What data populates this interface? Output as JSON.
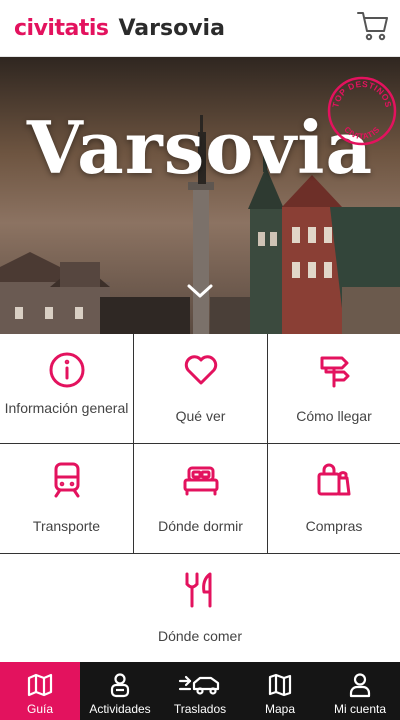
{
  "header": {
    "logo": "civitatis",
    "city": "Varsovia",
    "cart_icon": "cart-icon"
  },
  "hero": {
    "title": "Varsovia",
    "badge_top": "TOP DESTINOS",
    "badge_bottom": "CIVITATIS",
    "scroll_icon": "chevron-down-icon"
  },
  "menu": [
    {
      "label": "Información general",
      "icon": "info-icon"
    },
    {
      "label": "Qué ver",
      "icon": "heart-icon"
    },
    {
      "label": "Cómo llegar",
      "icon": "signpost-icon"
    },
    {
      "label": "Transporte",
      "icon": "train-icon"
    },
    {
      "label": "Dónde dormir",
      "icon": "bed-icon"
    },
    {
      "label": "Compras",
      "icon": "shopping-bags-icon"
    },
    {
      "label": "Dónde comer",
      "icon": "fork-knife-icon"
    }
  ],
  "bottom_nav": [
    {
      "label": "Guía",
      "icon": "map-icon",
      "active": true
    },
    {
      "label": "Actividades",
      "icon": "person-icon"
    },
    {
      "label": "Traslados",
      "icon": "car-icon"
    },
    {
      "label": "Mapa",
      "icon": "folded-map-icon"
    },
    {
      "label": "Mi cuenta",
      "icon": "user-icon"
    }
  ],
  "colors": {
    "brand": "#e3125e",
    "nav_bg": "#151515",
    "text": "#444444"
  }
}
